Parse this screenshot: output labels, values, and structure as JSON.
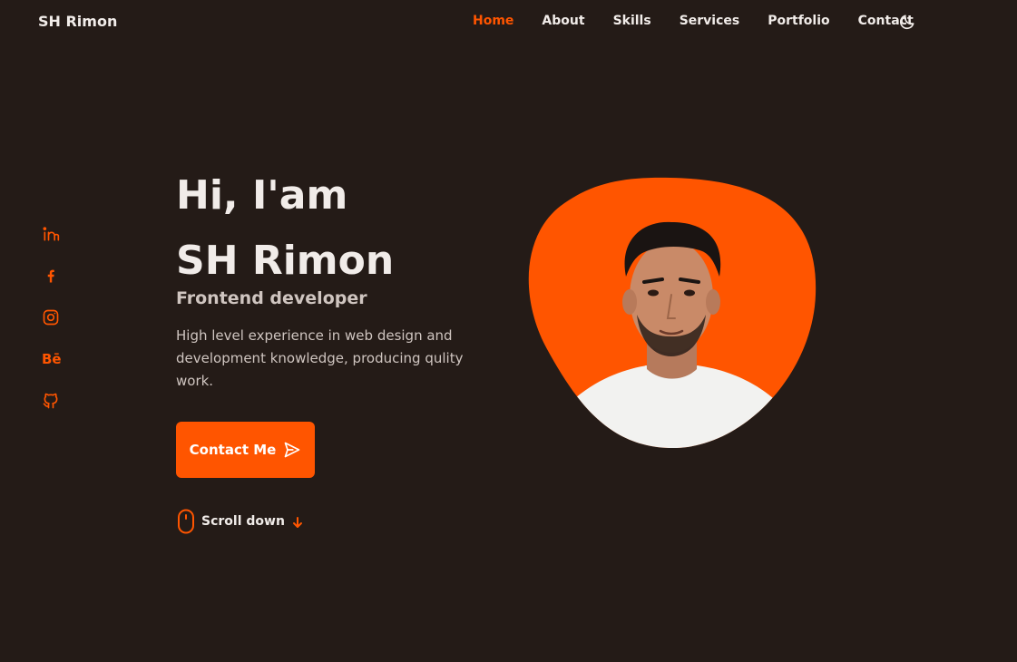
{
  "header": {
    "brand": "SH Rimon",
    "nav": [
      {
        "label": "Home",
        "active": true
      },
      {
        "label": "About",
        "active": false
      },
      {
        "label": "Skills",
        "active": false
      },
      {
        "label": "Services",
        "active": false
      },
      {
        "label": "Portfolio",
        "active": false
      },
      {
        "label": "Contact",
        "active": false
      }
    ],
    "theme_toggle_icon": "moon-icon"
  },
  "social": {
    "icons": [
      "linkedin-icon",
      "facebook-icon",
      "instagram-icon",
      "behance-icon",
      "github-icon"
    ],
    "behance_text": "Bē"
  },
  "hero": {
    "greeting": "Hi, I'am",
    "name": "SH Rimon",
    "subtitle": "Frontend developer",
    "description": "High level experience in web design and development knowledge, producing qulity work.",
    "cta_label": "Contact Me",
    "cta_icon": "send-icon",
    "scroll_label": "Scroll down",
    "scroll_icons": [
      "mouse-icon",
      "arrow-down-icon"
    ]
  },
  "colors": {
    "background": "#241b17",
    "accent": "#ff5500",
    "text": "#f1ece9",
    "muted_text": "#cfc5c0"
  }
}
